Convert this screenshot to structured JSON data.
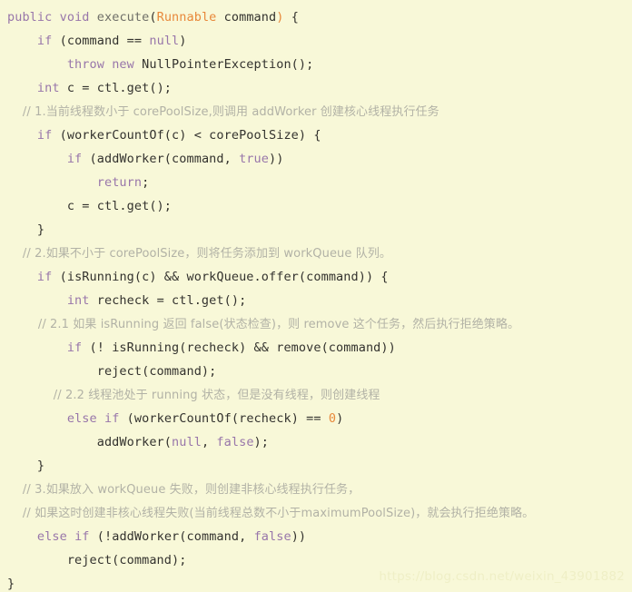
{
  "theme": {
    "background": "#f8f8d8",
    "plain_color": "#33322e",
    "keyword_color": "#9876aa",
    "type_color": "#e8883a",
    "number_color": "#e8883a",
    "comment_color": "#b2b2a6",
    "method_color": "#6f6f68",
    "watermark_color": "#efefc6"
  },
  "watermark": {
    "text": "https://blog.csdn.net/weixin_43901882"
  },
  "code": {
    "language": "java",
    "plain_text": "public void execute(Runnable command) {\n    if (command == null)\n        throw new NullPointerException();\n    int c = ctl.get();\n    // 1.当前线程数小于 corePoolSize,则调用 addWorker 创建核心线程执行任务\n    if (workerCountOf(c) < corePoolSize) {\n        if (addWorker(command, true))\n            return;\n        c = ctl.get();\n    }\n    // 2.如果不小于 corePoolSize，则将任务添加到 workQueue 队列。\n    if (isRunning(c) && workQueue.offer(command)) {\n        int recheck = ctl.get();\n        // 2.1 如果 isRunning 返回 false(状态检查)，则 remove 这个任务，然后执行拒绝策略。\n        if (! isRunning(recheck) && remove(command))\n            reject(command);\n            // 2.2 线程池处于 running 状态，但是没有线程，则创建线程\n        else if (workerCountOf(recheck) == 0)\n            addWorker(null, false);\n    }\n    // 3.如果放入 workQueue 失败，则创建非核心线程执行任务，\n    // 如果这时创建非核心线程失败(当前线程总数不小于maximumPoolSize)，就会执行拒绝策略。\n    else if (!addWorker(command, false))\n        reject(command);\n}",
    "lines": [
      {
        "n": 1,
        "tokens": [
          {
            "t": "public",
            "c": "keyword"
          },
          {
            "t": " ",
            "c": "plain"
          },
          {
            "t": "void",
            "c": "keyword"
          },
          {
            "t": " ",
            "c": "plain"
          },
          {
            "t": "execute",
            "c": "method"
          },
          {
            "t": "(",
            "c": "punct"
          },
          {
            "t": "Runnable",
            "c": "type"
          },
          {
            "t": " command",
            "c": "plain"
          },
          {
            "t": ")",
            "c": "type"
          },
          {
            "t": " {",
            "c": "plain"
          }
        ]
      },
      {
        "n": 2,
        "tokens": [
          {
            "t": "    ",
            "c": "plain"
          },
          {
            "t": "if",
            "c": "keyword"
          },
          {
            "t": " (command == ",
            "c": "plain"
          },
          {
            "t": "null",
            "c": "keyword"
          },
          {
            "t": ")",
            "c": "plain"
          }
        ]
      },
      {
        "n": 3,
        "tokens": [
          {
            "t": "        ",
            "c": "plain"
          },
          {
            "t": "throw",
            "c": "keyword"
          },
          {
            "t": " ",
            "c": "plain"
          },
          {
            "t": "new",
            "c": "keyword"
          },
          {
            "t": " NullPointerException();",
            "c": "plain"
          }
        ]
      },
      {
        "n": 4,
        "tokens": [
          {
            "t": "    ",
            "c": "plain"
          },
          {
            "t": "int",
            "c": "keyword"
          },
          {
            "t": " c = ctl.get();",
            "c": "plain"
          }
        ]
      },
      {
        "n": 5,
        "tokens": [
          {
            "t": "    // 1.当前线程数小于 corePoolSize,则调用 addWorker 创建核心线程执行任务",
            "c": "comment"
          }
        ]
      },
      {
        "n": 6,
        "tokens": [
          {
            "t": "    ",
            "c": "plain"
          },
          {
            "t": "if",
            "c": "keyword"
          },
          {
            "t": " (workerCountOf(c) < corePoolSize) {",
            "c": "plain"
          }
        ]
      },
      {
        "n": 7,
        "tokens": [
          {
            "t": "        ",
            "c": "plain"
          },
          {
            "t": "if",
            "c": "keyword"
          },
          {
            "t": " (addWorker(command, ",
            "c": "plain"
          },
          {
            "t": "true",
            "c": "keyword"
          },
          {
            "t": "))",
            "c": "plain"
          }
        ]
      },
      {
        "n": 8,
        "tokens": [
          {
            "t": "            ",
            "c": "plain"
          },
          {
            "t": "return",
            "c": "keyword"
          },
          {
            "t": ";",
            "c": "plain"
          }
        ]
      },
      {
        "n": 9,
        "tokens": [
          {
            "t": "        c = ctl.get();",
            "c": "plain"
          }
        ]
      },
      {
        "n": 10,
        "tokens": [
          {
            "t": "    }",
            "c": "plain"
          }
        ]
      },
      {
        "n": 11,
        "tokens": [
          {
            "t": "    // 2.如果不小于 corePoolSize，则将任务添加到 workQueue 队列。",
            "c": "comment"
          }
        ]
      },
      {
        "n": 12,
        "tokens": [
          {
            "t": "    ",
            "c": "plain"
          },
          {
            "t": "if",
            "c": "keyword"
          },
          {
            "t": " (isRunning(c) && workQueue.offer(command)) {",
            "c": "plain"
          }
        ]
      },
      {
        "n": 13,
        "tokens": [
          {
            "t": "        ",
            "c": "plain"
          },
          {
            "t": "int",
            "c": "keyword"
          },
          {
            "t": " recheck = ctl.get();",
            "c": "plain"
          }
        ]
      },
      {
        "n": 14,
        "tokens": [
          {
            "t": "        // 2.1 如果 isRunning 返回 false(状态检查)，则 remove 这个任务，然后执行拒绝策略。",
            "c": "comment"
          }
        ]
      },
      {
        "n": 15,
        "tokens": [
          {
            "t": "        ",
            "c": "plain"
          },
          {
            "t": "if",
            "c": "keyword"
          },
          {
            "t": " (! isRunning(recheck) && remove(command))",
            "c": "plain"
          }
        ]
      },
      {
        "n": 16,
        "tokens": [
          {
            "t": "            reject(command);",
            "c": "plain"
          }
        ]
      },
      {
        "n": 17,
        "tokens": [
          {
            "t": "            // 2.2 线程池处于 running 状态，但是没有线程，则创建线程",
            "c": "comment"
          }
        ]
      },
      {
        "n": 18,
        "tokens": [
          {
            "t": "        ",
            "c": "plain"
          },
          {
            "t": "else",
            "c": "keyword"
          },
          {
            "t": " ",
            "c": "plain"
          },
          {
            "t": "if",
            "c": "keyword"
          },
          {
            "t": " (workerCountOf(recheck) == ",
            "c": "plain"
          },
          {
            "t": "0",
            "c": "number"
          },
          {
            "t": ")",
            "c": "plain"
          }
        ]
      },
      {
        "n": 19,
        "tokens": [
          {
            "t": "            addWorker(",
            "c": "plain"
          },
          {
            "t": "null",
            "c": "keyword"
          },
          {
            "t": ", ",
            "c": "plain"
          },
          {
            "t": "false",
            "c": "keyword"
          },
          {
            "t": ");",
            "c": "plain"
          }
        ]
      },
      {
        "n": 20,
        "tokens": [
          {
            "t": "    }",
            "c": "plain"
          }
        ]
      },
      {
        "n": 21,
        "tokens": [
          {
            "t": "    // 3.如果放入 workQueue 失败，则创建非核心线程执行任务，",
            "c": "comment"
          }
        ]
      },
      {
        "n": 22,
        "tokens": [
          {
            "t": "    // 如果这时创建非核心线程失败(当前线程总数不小于maximumPoolSize)，就会执行拒绝策略。",
            "c": "comment"
          }
        ]
      },
      {
        "n": 23,
        "tokens": [
          {
            "t": "    ",
            "c": "plain"
          },
          {
            "t": "else",
            "c": "keyword"
          },
          {
            "t": " ",
            "c": "plain"
          },
          {
            "t": "if",
            "c": "keyword"
          },
          {
            "t": " (!addWorker(command, ",
            "c": "plain"
          },
          {
            "t": "false",
            "c": "keyword"
          },
          {
            "t": "))",
            "c": "plain"
          }
        ]
      },
      {
        "n": 24,
        "tokens": [
          {
            "t": "        reject(command);",
            "c": "plain"
          }
        ]
      },
      {
        "n": 25,
        "tokens": [
          {
            "t": "}",
            "c": "plain"
          }
        ]
      }
    ]
  }
}
